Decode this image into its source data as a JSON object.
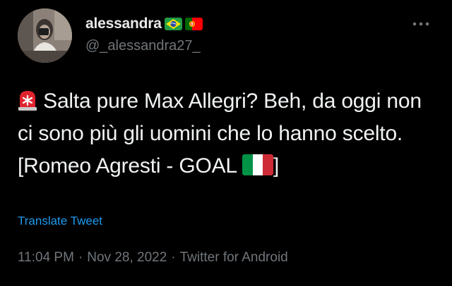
{
  "user": {
    "display_name": "alessandra",
    "handle": "@_alessandra27_",
    "flags": [
      "brazil-flag",
      "portugal-flag"
    ]
  },
  "tweet": {
    "leading_emoji": "police-car-light",
    "text": "Salta pure Max Allegri? Beh, da oggi non ci sono più gli uomini che lo hanno scelto. [Romeo Agresti - GOAL",
    "trailing_emoji": "italy-flag",
    "closing": "]"
  },
  "actions": {
    "translate_label": "Translate Tweet",
    "more_icon": "more-horizontal-icon"
  },
  "meta": {
    "time": "11:04 PM",
    "separator": "·",
    "date": "Nov 28, 2022",
    "source": "Twitter for Android"
  },
  "colors": {
    "background": "#000000",
    "text": "#e7e9ea",
    "secondary": "#71767b",
    "link": "#1d9bf0"
  }
}
